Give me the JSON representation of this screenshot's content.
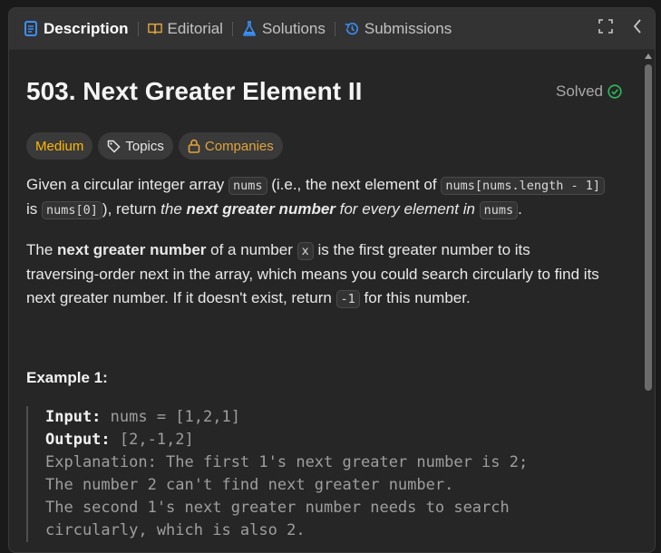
{
  "tabs": [
    {
      "label": "Description",
      "icon": "description-icon",
      "active": true
    },
    {
      "label": "Editorial",
      "icon": "book-icon",
      "active": false
    },
    {
      "label": "Solutions",
      "icon": "flask-icon",
      "active": false
    },
    {
      "label": "Submissions",
      "icon": "history-icon",
      "active": false
    }
  ],
  "toolbar": {
    "icons": [
      "expand-icon",
      "chevron-left-icon"
    ]
  },
  "problem": {
    "title": "503. Next Greater Element II",
    "status": "Solved",
    "difficulty": "Medium",
    "topics_label": "Topics",
    "companies_label": "Companies"
  },
  "description": {
    "p1_a": "Given a circular integer array ",
    "p1_code1": "nums",
    "p1_b": " (i.e., the next element of ",
    "p1_code2": "nums[nums.length - 1]",
    "p1_c": " is ",
    "p1_code3": "nums[0]",
    "p1_d": "), return ",
    "p1_em1": "the ",
    "p1_strong": "next greater number",
    "p1_em2": " for every element in",
    "p1_e": " ",
    "p1_code4": "nums",
    "p1_f": ".",
    "p2_a": "The ",
    "p2_strong": "next greater number",
    "p2_b": " of a number ",
    "p2_code1": "x",
    "p2_c": " is the first greater number to its traversing-order next in the array, which means you could search circularly to find its next greater number. If it doesn't exist, return ",
    "p2_code2": "-1",
    "p2_d": " for this number."
  },
  "example": {
    "title": "Example 1:",
    "input_label": "Input:",
    "input_value": " nums = [1,2,1]",
    "output_label": "Output:",
    "output_value": " [2,-1,2]",
    "explanation_lines": [
      "Explanation: The first 1's next greater number is 2;",
      "The number 2 can't find next greater number.",
      "The second 1's next greater number needs to search",
      "circularly, which is also 2."
    ]
  },
  "colors": {
    "accent_medium": "#ffb800",
    "solved_check": "#2cbb5d",
    "tab_icon_blue": "#3a8ef6"
  }
}
